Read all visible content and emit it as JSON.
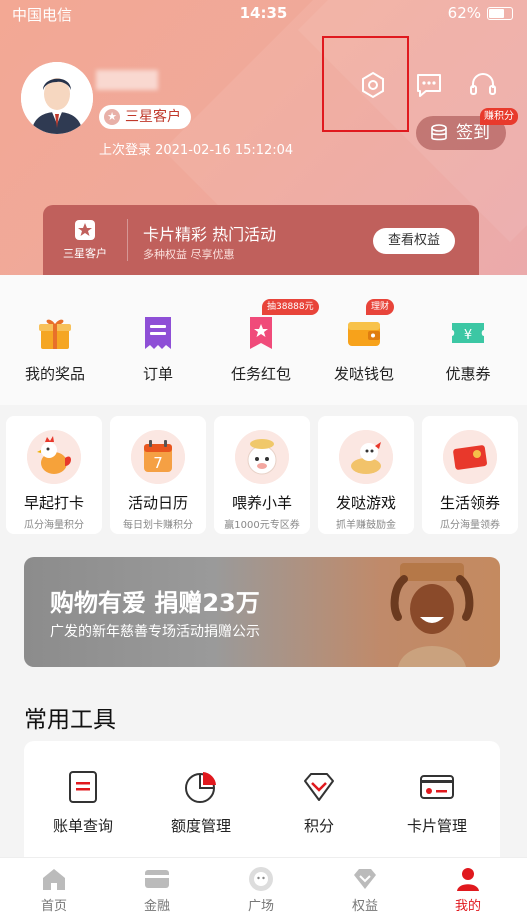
{
  "status_bar": {
    "carrier": "中国电信",
    "time": "14:35",
    "battery": "62%"
  },
  "profile": {
    "tier": "三星客户",
    "last_login": "上次登录 2021-02-16 15:12:04"
  },
  "header_actions": {
    "checkin_label": "签到",
    "earn_badge": "赚积分"
  },
  "banner": {
    "tier_label": "三星客户",
    "title": "卡片精彩 热门活动",
    "subtitle": "多种权益 尽享优惠",
    "button": "查看权益"
  },
  "quick_items": [
    {
      "label": "我的奖品",
      "icon": "gift-icon"
    },
    {
      "label": "订单",
      "icon": "receipt-icon"
    },
    {
      "label": "任务红包",
      "icon": "red-packet-icon",
      "badge": "抽38888元"
    },
    {
      "label": "发哒钱包",
      "icon": "wallet-icon",
      "badge": "理财"
    },
    {
      "label": "优惠券",
      "icon": "coupon-icon"
    }
  ],
  "games": [
    {
      "title": "早起打卡",
      "sub": "瓜分海量积分",
      "icon": "rooster-icon"
    },
    {
      "title": "活动日历",
      "sub": "每日划卡赚积分",
      "icon": "calendar-icon",
      "day": "7"
    },
    {
      "title": "喂养小羊",
      "sub": "赢1000元专区券",
      "icon": "sheep-icon"
    },
    {
      "title": "发哒游戏",
      "sub": "抓羊赚鼓励金",
      "icon": "game-icon"
    },
    {
      "title": "生活领券",
      "sub": "瓜分海量领券",
      "icon": "voucher-icon"
    }
  ],
  "promo": {
    "title": "购物有爱  捐赠23万",
    "subtitle": "广发的新年慈善专场活动捐赠公示"
  },
  "tools": {
    "title": "常用工具",
    "items": [
      {
        "label": "账单查询",
        "icon": "bill-icon"
      },
      {
        "label": "额度管理",
        "icon": "pie-chart-icon"
      },
      {
        "label": "积分",
        "icon": "diamond-icon"
      },
      {
        "label": "卡片管理",
        "icon": "card-icon"
      }
    ]
  },
  "tabbar": [
    {
      "label": "首页",
      "icon": "home-icon"
    },
    {
      "label": "金融",
      "icon": "card-tab-icon"
    },
    {
      "label": "广场",
      "icon": "plaza-icon"
    },
    {
      "label": "权益",
      "icon": "benefit-icon"
    },
    {
      "label": "我的",
      "icon": "user-icon",
      "active": true
    }
  ],
  "colors": {
    "accent": "#e0191e",
    "header": "#f0a99a",
    "banner": "#c0605c"
  }
}
